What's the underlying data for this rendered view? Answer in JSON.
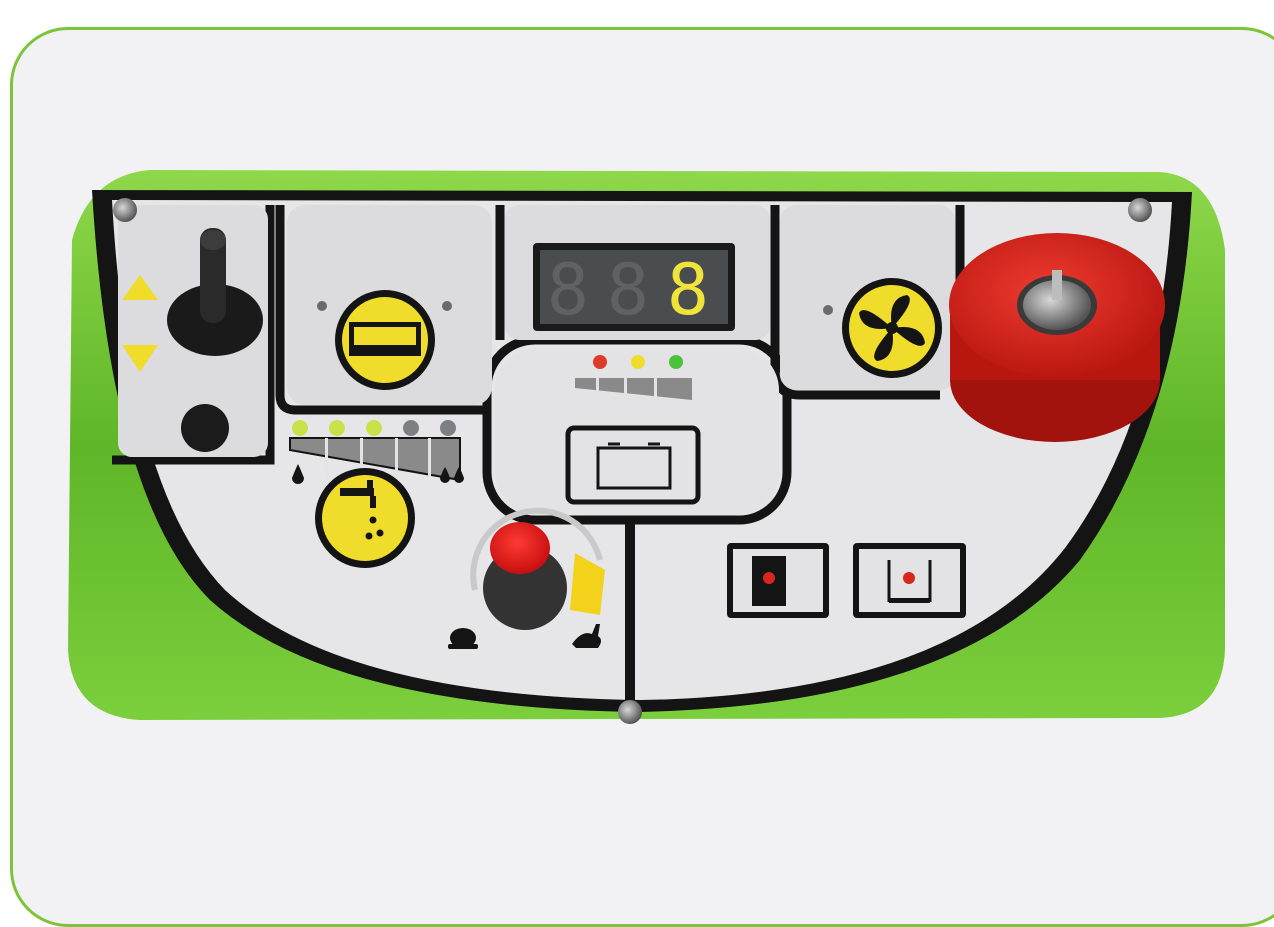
{
  "image": {
    "subject": "scrubber-dryer-control-panel",
    "colors": {
      "frame_border": "#7cc43a",
      "frame_fill": "#f2f2f4",
      "machine_green": "#6cc22c",
      "panel_black": "#141414",
      "panel_face": "#e6e6e8",
      "symbol_yellow": "#f0dc2a",
      "emergency_red": "#d8261e",
      "led_green": "#c9e24a",
      "led_red": "#e03a2a",
      "display_digit": "#f2e33a"
    },
    "display": {
      "digits": [
        "8",
        "8",
        "8"
      ],
      "lit_digit_index": 2
    },
    "battery_leds": [
      "red",
      "yellow",
      "green"
    ],
    "water_flow_leds": [
      "lit",
      "lit",
      "lit",
      "off",
      "off"
    ],
    "icons": [
      "lever-up-arrow-icon",
      "lever-down-arrow-icon",
      "brush-icon",
      "fan-icon",
      "water-tap-icon",
      "battery-icon",
      "snail-icon",
      "hare-icon",
      "brush-motor-switch-icon",
      "vacuum-switch-icon"
    ]
  }
}
